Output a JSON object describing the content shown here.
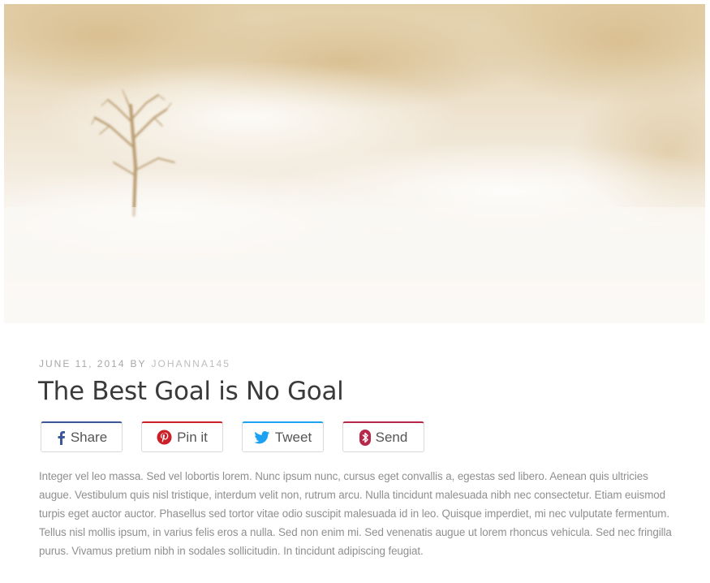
{
  "hero": {
    "image_alt": "Lone bare tree in a warm golden fog"
  },
  "post": {
    "date": "June 11, 2014",
    "by_label": "By",
    "author": "johanna145",
    "title": "The Best Goal is No Goal",
    "body": "Integer vel leo massa. Sed vel lobortis lorem. Nunc ipsum nunc, cursus eget convallis a, egestas sed libero. Aenean quis ultricies augue. Vestibulum quis nisl tristique, interdum velit non, rutrum arcu. Nulla tincidunt malesuada nibh nec consectetur. Etiam euismod turpis eget auctor auctor. Phasellus sed tortor vitae odio suscipit malesuada id in leo. Quisque imperdiet, mi nec vulputate fermentum. Tellus nisl mollis ipsum, in varius felis eros a nulla. Sed non enim mi. Sed venenatis augue ut lorem rhoncus vehicula. Sed nec fringilla purus. Vivamus pretium nibh in sodales sollicitudin. In tincidunt adipiscing feugiat."
  },
  "share": {
    "facebook": {
      "label": "Share",
      "icon": "facebook-icon",
      "color": "#3b5998"
    },
    "pinterest": {
      "label": "Pin it",
      "icon": "pinterest-icon",
      "color": "#cb2027"
    },
    "twitter": {
      "label": "Tweet",
      "icon": "twitter-icon",
      "color": "#1da1f2"
    },
    "send": {
      "label": "Send",
      "icon": "bluetooth-icon",
      "color": "#b8284a"
    }
  }
}
